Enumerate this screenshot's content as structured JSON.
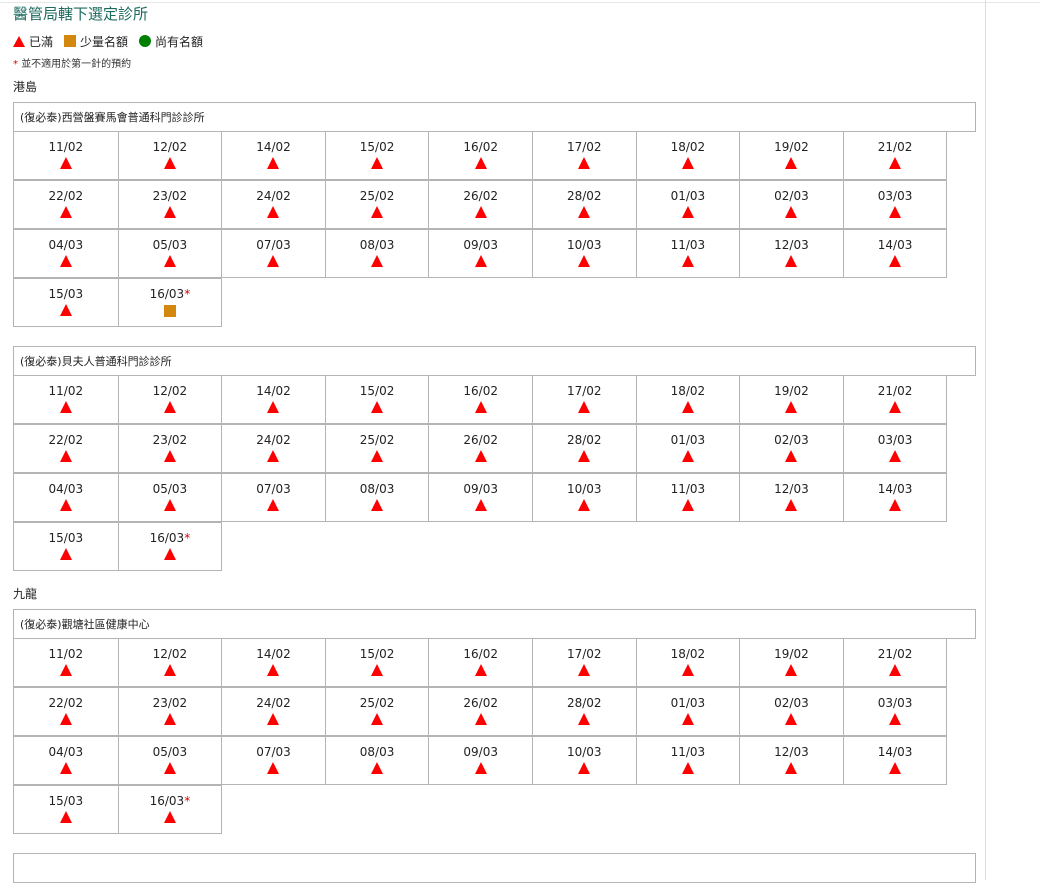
{
  "title": "醫管局轄下選定診所",
  "legend": [
    {
      "symbol": "full",
      "label": "已滿"
    },
    {
      "symbol": "limited",
      "label": "少量名額"
    },
    {
      "symbol": "available",
      "label": "尚有名額"
    }
  ],
  "note": {
    "asterisk": "*",
    "text": "並不適用於第一針的預約"
  },
  "symbols": {
    "full": {
      "name": "red-triangle-icon",
      "color": "#ff0000"
    },
    "limited": {
      "name": "orange-square-icon",
      "color": "#d4870e"
    },
    "available": {
      "name": "green-circle-icon",
      "color": "#008000"
    }
  },
  "regions": [
    {
      "name": "港島",
      "clinics": [
        {
          "name": "(復必泰)西營盤賽馬會普通科門診診所",
          "slots": [
            {
              "date": "11/02",
              "status": "full"
            },
            {
              "date": "12/02",
              "status": "full"
            },
            {
              "date": "14/02",
              "status": "full"
            },
            {
              "date": "15/02",
              "status": "full"
            },
            {
              "date": "16/02",
              "status": "full"
            },
            {
              "date": "17/02",
              "status": "full"
            },
            {
              "date": "18/02",
              "status": "full"
            },
            {
              "date": "19/02",
              "status": "full"
            },
            {
              "date": "21/02",
              "status": "full"
            },
            {
              "date": "22/02",
              "status": "full"
            },
            {
              "date": "23/02",
              "status": "full"
            },
            {
              "date": "24/02",
              "status": "full"
            },
            {
              "date": "25/02",
              "status": "full"
            },
            {
              "date": "26/02",
              "status": "full"
            },
            {
              "date": "28/02",
              "status": "full"
            },
            {
              "date": "01/03",
              "status": "full"
            },
            {
              "date": "02/03",
              "status": "full"
            },
            {
              "date": "03/03",
              "status": "full"
            },
            {
              "date": "04/03",
              "status": "full"
            },
            {
              "date": "05/03",
              "status": "full"
            },
            {
              "date": "07/03",
              "status": "full"
            },
            {
              "date": "08/03",
              "status": "full"
            },
            {
              "date": "09/03",
              "status": "full"
            },
            {
              "date": "10/03",
              "status": "full"
            },
            {
              "date": "11/03",
              "status": "full"
            },
            {
              "date": "12/03",
              "status": "full"
            },
            {
              "date": "14/03",
              "status": "full"
            },
            {
              "date": "15/03",
              "status": "full"
            },
            {
              "date": "16/03",
              "status": "limited",
              "asterisk": "*"
            }
          ]
        },
        {
          "name": "(復必泰)貝夫人普通科門診診所",
          "slots": [
            {
              "date": "11/02",
              "status": "full"
            },
            {
              "date": "12/02",
              "status": "full"
            },
            {
              "date": "14/02",
              "status": "full"
            },
            {
              "date": "15/02",
              "status": "full"
            },
            {
              "date": "16/02",
              "status": "full"
            },
            {
              "date": "17/02",
              "status": "full"
            },
            {
              "date": "18/02",
              "status": "full"
            },
            {
              "date": "19/02",
              "status": "full"
            },
            {
              "date": "21/02",
              "status": "full"
            },
            {
              "date": "22/02",
              "status": "full"
            },
            {
              "date": "23/02",
              "status": "full"
            },
            {
              "date": "24/02",
              "status": "full"
            },
            {
              "date": "25/02",
              "status": "full"
            },
            {
              "date": "26/02",
              "status": "full"
            },
            {
              "date": "28/02",
              "status": "full"
            },
            {
              "date": "01/03",
              "status": "full"
            },
            {
              "date": "02/03",
              "status": "full"
            },
            {
              "date": "03/03",
              "status": "full"
            },
            {
              "date": "04/03",
              "status": "full"
            },
            {
              "date": "05/03",
              "status": "full"
            },
            {
              "date": "07/03",
              "status": "full"
            },
            {
              "date": "08/03",
              "status": "full"
            },
            {
              "date": "09/03",
              "status": "full"
            },
            {
              "date": "10/03",
              "status": "full"
            },
            {
              "date": "11/03",
              "status": "full"
            },
            {
              "date": "12/03",
              "status": "full"
            },
            {
              "date": "14/03",
              "status": "full"
            },
            {
              "date": "15/03",
              "status": "full"
            },
            {
              "date": "16/03",
              "status": "full",
              "asterisk": "*"
            }
          ]
        }
      ]
    },
    {
      "name": "九龍",
      "clinics": [
        {
          "name": "(復必泰)觀塘社區健康中心",
          "slots": [
            {
              "date": "11/02",
              "status": "full"
            },
            {
              "date": "12/02",
              "status": "full"
            },
            {
              "date": "14/02",
              "status": "full"
            },
            {
              "date": "15/02",
              "status": "full"
            },
            {
              "date": "16/02",
              "status": "full"
            },
            {
              "date": "17/02",
              "status": "full"
            },
            {
              "date": "18/02",
              "status": "full"
            },
            {
              "date": "19/02",
              "status": "full"
            },
            {
              "date": "21/02",
              "status": "full"
            },
            {
              "date": "22/02",
              "status": "full"
            },
            {
              "date": "23/02",
              "status": "full"
            },
            {
              "date": "24/02",
              "status": "full"
            },
            {
              "date": "25/02",
              "status": "full"
            },
            {
              "date": "26/02",
              "status": "full"
            },
            {
              "date": "28/02",
              "status": "full"
            },
            {
              "date": "01/03",
              "status": "full"
            },
            {
              "date": "02/03",
              "status": "full"
            },
            {
              "date": "03/03",
              "status": "full"
            },
            {
              "date": "04/03",
              "status": "full"
            },
            {
              "date": "05/03",
              "status": "full"
            },
            {
              "date": "07/03",
              "status": "full"
            },
            {
              "date": "08/03",
              "status": "full"
            },
            {
              "date": "09/03",
              "status": "full"
            },
            {
              "date": "10/03",
              "status": "full"
            },
            {
              "date": "11/03",
              "status": "full"
            },
            {
              "date": "12/03",
              "status": "full"
            },
            {
              "date": "14/03",
              "status": "full"
            },
            {
              "date": "15/03",
              "status": "full"
            },
            {
              "date": "16/03",
              "status": "full",
              "asterisk": "*"
            }
          ]
        },
        {
          "name": "",
          "slots": []
        }
      ]
    }
  ]
}
